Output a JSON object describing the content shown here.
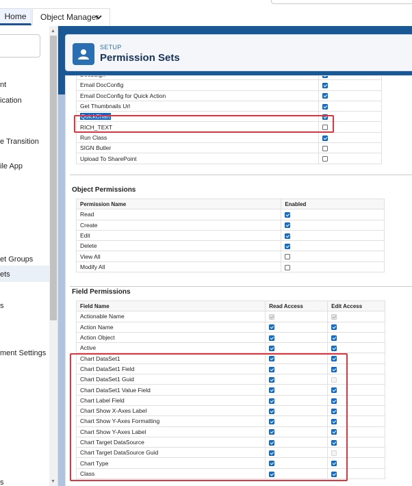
{
  "topnav": {
    "tabs": [
      {
        "label": "Home"
      },
      {
        "label": "Object Manager"
      }
    ]
  },
  "sidebar": {
    "items": [
      {
        "label": "nt"
      },
      {
        "label": "ication"
      },
      {
        "label": "e Transition"
      },
      {
        "label": "ile App"
      },
      {
        "label": "et Groups"
      },
      {
        "label": "ets"
      },
      {
        "label": "s"
      },
      {
        "label": "ment Settings"
      },
      {
        "label": "s"
      }
    ]
  },
  "header": {
    "setup_label": "SETUP",
    "title": "Permission Sets"
  },
  "apex_rows": [
    {
      "name": "DocuSign",
      "enabled": "on"
    },
    {
      "name": "Email DocConfig",
      "enabled": "on"
    },
    {
      "name": "Email DocConfig for Quick Action",
      "enabled": "on"
    },
    {
      "name": "Get Thumbnails Url",
      "enabled": "on"
    },
    {
      "name": "QuickChart",
      "enabled": "on"
    },
    {
      "name": "RICH_TEXT",
      "enabled": "off"
    },
    {
      "name": "Run Class",
      "enabled": "on"
    },
    {
      "name": "SIGN Butler",
      "enabled": "off"
    },
    {
      "name": "Upload To SharePoint",
      "enabled": "off"
    }
  ],
  "object_permissions": {
    "title": "Object Permissions",
    "headers": [
      "Permission Name",
      "Enabled"
    ],
    "rows": [
      {
        "name": "Read",
        "enabled": "on"
      },
      {
        "name": "Create",
        "enabled": "on"
      },
      {
        "name": "Edit",
        "enabled": "on"
      },
      {
        "name": "Delete",
        "enabled": "on"
      },
      {
        "name": "View All",
        "enabled": "off"
      },
      {
        "name": "Modify All",
        "enabled": "off"
      }
    ]
  },
  "field_permissions": {
    "title": "Field Permissions",
    "headers": [
      "Field Name",
      "Read Access",
      "Edit Access"
    ],
    "rows": [
      {
        "name": "Actionable Name",
        "read": "dis",
        "edit": "dis"
      },
      {
        "name": "Action Name",
        "read": "on",
        "edit": "on"
      },
      {
        "name": "Action Object",
        "read": "on",
        "edit": "on"
      },
      {
        "name": "Active",
        "read": "on",
        "edit": "on"
      },
      {
        "name": "Chart DataSet1",
        "read": "on",
        "edit": "on"
      },
      {
        "name": "Chart DataSet1 Field",
        "read": "on",
        "edit": "on"
      },
      {
        "name": "Chart DataSet1 Guid",
        "read": "on",
        "edit": "disoff"
      },
      {
        "name": "Chart DataSet1 Value Field",
        "read": "on",
        "edit": "on"
      },
      {
        "name": "Chart Label Field",
        "read": "on",
        "edit": "on"
      },
      {
        "name": "Chart Show X-Axes Label",
        "read": "on",
        "edit": "on"
      },
      {
        "name": "Chart Show Y-Axes Formatting",
        "read": "on",
        "edit": "on"
      },
      {
        "name": "Chart Show Y-Axes Label",
        "read": "on",
        "edit": "on"
      },
      {
        "name": "Chart Target DataSource",
        "read": "on",
        "edit": "on"
      },
      {
        "name": "Chart Target DataSource Guid",
        "read": "on",
        "edit": "disoff"
      },
      {
        "name": "Chart Type",
        "read": "on",
        "edit": "on"
      },
      {
        "name": "Class",
        "read": "on",
        "edit": "on"
      }
    ]
  },
  "colors": {
    "accent": "#1172d8",
    "highlight_box": "#e0353e",
    "header_band": "#1a5795"
  }
}
